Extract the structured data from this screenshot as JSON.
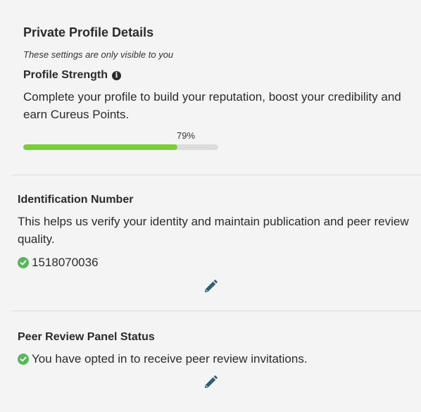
{
  "private_profile": {
    "title": "Private Profile Details",
    "visibility_note": "These settings are only visible to you",
    "strength": {
      "title": "Profile Strength",
      "description": "Complete your profile to build your reputation, boost your credibility and earn Cureus Points.",
      "progress_label": "79%",
      "progress_value": 0.79
    }
  },
  "identification": {
    "title": "Identification Number",
    "description": "This helps us verify your identity and maintain publication and peer review quality.",
    "number": "1518070036"
  },
  "peer_review": {
    "title": "Peer Review Panel Status",
    "status_text": "You have opted in to receive peer review invitations."
  },
  "icons": {
    "info": "info-icon",
    "check": "check-circle-icon",
    "edit": "pencil-icon"
  },
  "colors": {
    "progress_fill": "#7ccd3c",
    "progress_track": "#dcdcdc",
    "check": "#5ab65a",
    "edit_icon": "#2c5c7a"
  }
}
